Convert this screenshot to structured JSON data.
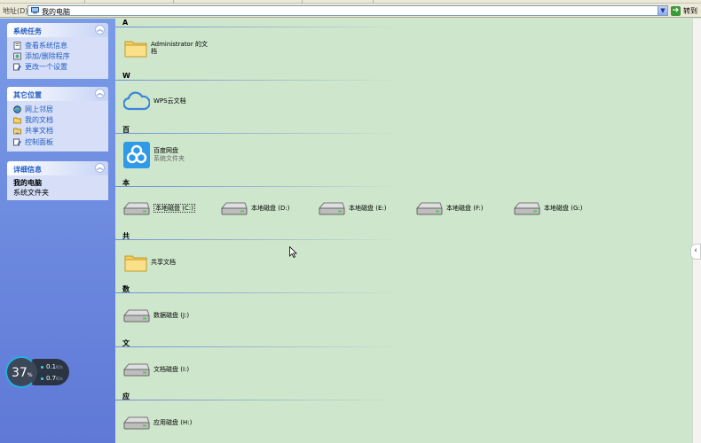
{
  "address_bar": {
    "label": "地址(D)",
    "value": "我的电脑",
    "go_label": "转到"
  },
  "sidebar": {
    "system_tasks": {
      "title": "系统任务",
      "items": [
        {
          "label": "查看系统信息",
          "icon": "system-info-icon"
        },
        {
          "label": "添加/删除程序",
          "icon": "add-remove-programs-icon"
        },
        {
          "label": "更改一个设置",
          "icon": "control-setting-icon"
        }
      ]
    },
    "other_places": {
      "title": "其它位置",
      "items": [
        {
          "label": "网上邻居",
          "icon": "network-icon"
        },
        {
          "label": "我的文档",
          "icon": "my-documents-icon"
        },
        {
          "label": "共享文档",
          "icon": "shared-folder-icon"
        },
        {
          "label": "控制面板",
          "icon": "control-panel-icon"
        }
      ]
    },
    "details": {
      "title": "详细信息",
      "name": "我的电脑",
      "type": "系统文件夹"
    }
  },
  "speed_widget": {
    "percent": "37",
    "percent_unit": "%",
    "upload": "0.1",
    "download": "0.7",
    "unit": "K/s"
  },
  "groups": [
    {
      "header": "A",
      "items": [
        {
          "label": "Administrator 的文档",
          "icon": "folder-icon"
        }
      ]
    },
    {
      "header": "W",
      "items": [
        {
          "label": "WPS云文档",
          "icon": "cloud-icon"
        }
      ]
    },
    {
      "header": "百",
      "items": [
        {
          "label": "百度网盘",
          "sub": "系统文件夹",
          "icon": "baidu-netdisk-icon"
        }
      ]
    },
    {
      "header": "本",
      "items": [
        {
          "label": "本地磁盘 (C:)",
          "icon": "drive-icon"
        },
        {
          "label": "本地磁盘 (D:)",
          "icon": "drive-icon"
        },
        {
          "label": "本地磁盘 (E:)",
          "icon": "drive-icon"
        },
        {
          "label": "本地磁盘 (F:)",
          "icon": "drive-icon"
        },
        {
          "label": "本地磁盘 (G:)",
          "icon": "drive-icon"
        }
      ]
    },
    {
      "header": "共",
      "items": [
        {
          "label": "共享文档",
          "icon": "folder-icon"
        }
      ]
    },
    {
      "header": "数",
      "items": [
        {
          "label": "数据磁盘 (J:)",
          "icon": "drive-icon"
        }
      ]
    },
    {
      "header": "文",
      "items": [
        {
          "label": "文档磁盘 (I:)",
          "icon": "drive-icon"
        }
      ]
    },
    {
      "header": "应",
      "items": [
        {
          "label": "应用磁盘 (H:)",
          "icon": "drive-icon"
        }
      ]
    }
  ],
  "colors": {
    "content_bg": "#cde6cc",
    "sidebar_bg": "#6b87dd",
    "task_link": "#215dc6"
  }
}
